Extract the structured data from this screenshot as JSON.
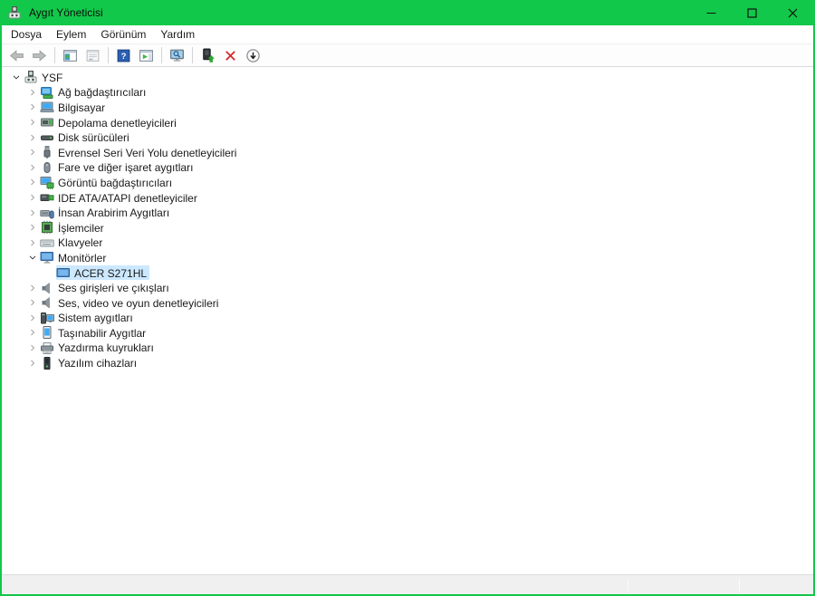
{
  "window": {
    "title": "Aygıt Yöneticisi",
    "icon": "device-manager",
    "controls": [
      {
        "name": "minimize",
        "glyph": "minimize"
      },
      {
        "name": "maximize",
        "glyph": "maximize"
      },
      {
        "name": "close",
        "glyph": "close"
      }
    ]
  },
  "colors": {
    "titlebar_green": "#12c84a",
    "selection_blue": "#cce8ff",
    "uninstall_red": "#d42a2a",
    "help_blue": "#2b5fb0",
    "statusbar_gray": "#f0f0f0"
  },
  "menu": {
    "items": [
      {
        "label": "Dosya"
      },
      {
        "label": "Eylem"
      },
      {
        "label": "Görünüm"
      },
      {
        "label": "Yardım"
      }
    ]
  },
  "toolbar": {
    "buttons": [
      {
        "name": "back",
        "icon": "back-arrow",
        "enabled": false
      },
      {
        "name": "forward",
        "icon": "forward-arrow",
        "enabled": false
      },
      {
        "separator": true
      },
      {
        "name": "show-console-tree",
        "icon": "console-tree",
        "enabled": true
      },
      {
        "name": "properties",
        "icon": "properties",
        "enabled": false
      },
      {
        "separator": true
      },
      {
        "name": "help",
        "icon": "help",
        "enabled": true
      },
      {
        "name": "show-action-pane",
        "icon": "action-pane",
        "enabled": true
      },
      {
        "separator": true
      },
      {
        "name": "scan-hardware-changes",
        "icon": "scan-hardware",
        "enabled": true
      },
      {
        "separator": true
      },
      {
        "name": "update-driver",
        "icon": "update-driver",
        "enabled": true
      },
      {
        "name": "uninstall-device",
        "icon": "uninstall",
        "enabled": true
      },
      {
        "name": "disable-device",
        "icon": "disable",
        "enabled": true
      }
    ]
  },
  "tree": {
    "items": [
      {
        "label": "YSF",
        "icon": "device-manager",
        "level": 0,
        "chevron": "expanded",
        "selected": false
      },
      {
        "label": "Ağ bağdaştırıcıları",
        "icon": "network-adapter",
        "level": 1,
        "chevron": "collapsed",
        "selected": false
      },
      {
        "label": "Bilgisayar",
        "icon": "computer",
        "level": 1,
        "chevron": "collapsed",
        "selected": false
      },
      {
        "label": "Depolama denetleyicileri",
        "icon": "storage-controller",
        "level": 1,
        "chevron": "collapsed",
        "selected": false
      },
      {
        "label": "Disk sürücüleri",
        "icon": "disk-drive",
        "level": 1,
        "chevron": "collapsed",
        "selected": false
      },
      {
        "label": "Evrensel Seri Veri Yolu denetleyicileri",
        "icon": "usb-controller",
        "level": 1,
        "chevron": "collapsed",
        "selected": false
      },
      {
        "label": "Fare ve diğer işaret aygıtları",
        "icon": "mouse",
        "level": 1,
        "chevron": "collapsed",
        "selected": false
      },
      {
        "label": "Görüntü bağdaştırıcıları",
        "icon": "display-adapter",
        "level": 1,
        "chevron": "collapsed",
        "selected": false
      },
      {
        "label": "IDE ATA/ATAPI denetleyiciler",
        "icon": "ide-controller",
        "level": 1,
        "chevron": "collapsed",
        "selected": false
      },
      {
        "label": "İnsan Arabirim Aygıtları",
        "icon": "hid-device",
        "level": 1,
        "chevron": "collapsed",
        "selected": false
      },
      {
        "label": "İşlemciler",
        "icon": "processor",
        "level": 1,
        "chevron": "collapsed",
        "selected": false
      },
      {
        "label": "Klavyeler",
        "icon": "keyboard",
        "level": 1,
        "chevron": "collapsed",
        "selected": false
      },
      {
        "label": "Monitörler",
        "icon": "monitor",
        "level": 1,
        "chevron": "expanded",
        "selected": false
      },
      {
        "label": "ACER S271HL",
        "icon": "monitor-device",
        "level": 2,
        "chevron": "none",
        "selected": true
      },
      {
        "label": "Ses girişleri ve çıkışları",
        "icon": "speaker",
        "level": 1,
        "chevron": "collapsed",
        "selected": false
      },
      {
        "label": "Ses, video ve oyun denetleyicileri",
        "icon": "speaker",
        "level": 1,
        "chevron": "collapsed",
        "selected": false
      },
      {
        "label": "Sistem aygıtları",
        "icon": "system-devices",
        "level": 1,
        "chevron": "collapsed",
        "selected": false
      },
      {
        "label": "Taşınabilir Aygıtlar",
        "icon": "portable-device",
        "level": 1,
        "chevron": "collapsed",
        "selected": false
      },
      {
        "label": "Yazdırma kuyrukları",
        "icon": "print-queue",
        "level": 1,
        "chevron": "collapsed",
        "selected": false
      },
      {
        "label": "Yazılım cihazları",
        "icon": "software-device",
        "level": 1,
        "chevron": "collapsed",
        "selected": false
      }
    ]
  },
  "statusbar": {
    "sections": [
      "",
      "",
      ""
    ]
  }
}
